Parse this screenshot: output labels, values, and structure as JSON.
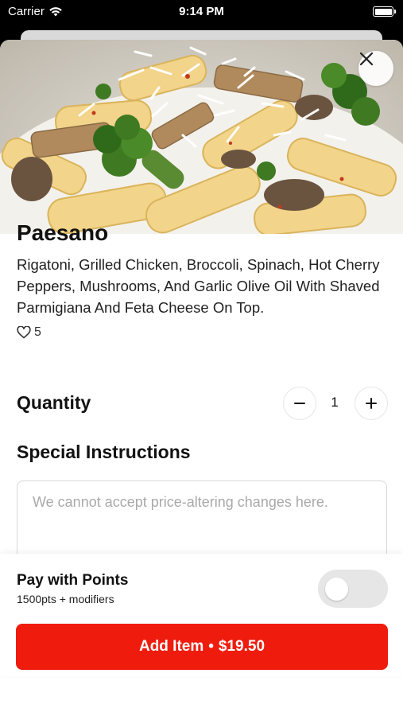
{
  "status_bar": {
    "carrier": "Carrier",
    "time": "9:14 PM"
  },
  "item": {
    "name": "Paesano",
    "description": "Rigatoni, Grilled Chicken, Broccoli, Spinach, Hot Cherry Peppers, Mushrooms, And Garlic Olive Oil With Shaved Parmigiana And Feta Cheese On Top.",
    "likes": "5"
  },
  "quantity": {
    "label": "Quantity",
    "value": "1"
  },
  "special_instructions": {
    "label": "Special Instructions",
    "placeholder": "We cannot accept price-altering changes here."
  },
  "points": {
    "title": "Pay with Points",
    "subtitle": "1500pts + modifiers",
    "enabled": false
  },
  "add_button": {
    "label": "Add Item",
    "separator": "•",
    "price": "$19.50"
  },
  "colors": {
    "accent": "#ef1c0d",
    "toggle_off": "#e6e6e6"
  }
}
